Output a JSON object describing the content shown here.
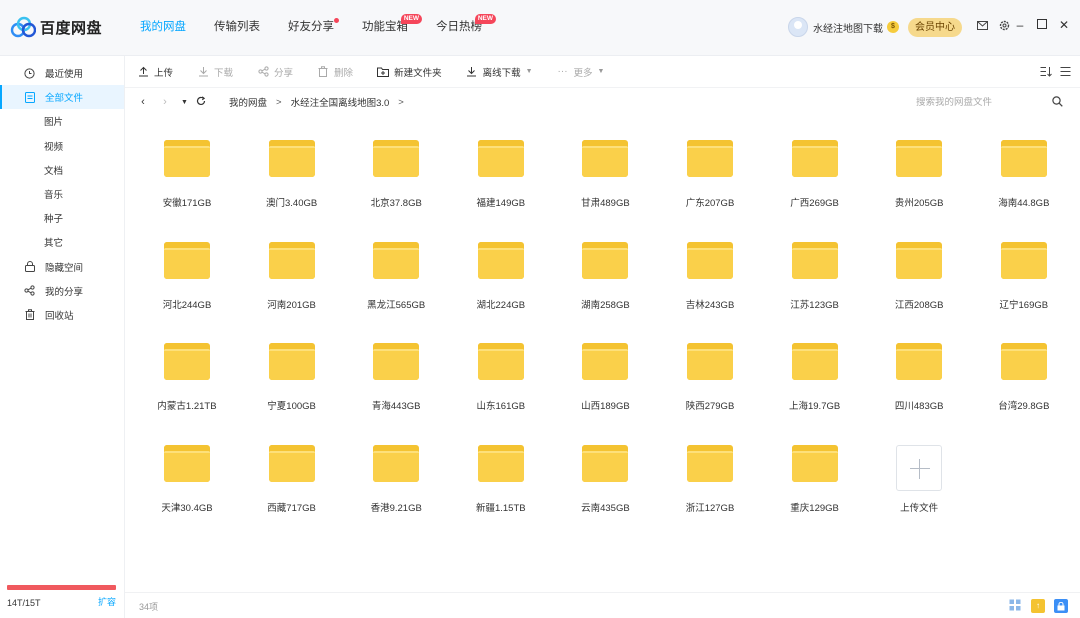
{
  "app": {
    "name": "百度网盘"
  },
  "nav": {
    "tabs": [
      {
        "label": "我的网盘",
        "active": true,
        "badge": ""
      },
      {
        "label": "传输列表",
        "active": false,
        "badge": ""
      },
      {
        "label": "好友分享",
        "active": false,
        "badge": "dot"
      },
      {
        "label": "功能宝箱",
        "active": false,
        "badge": "NEW"
      },
      {
        "label": "今日热榜",
        "active": false,
        "badge": "NEW"
      }
    ]
  },
  "user": {
    "name": "水经注地图下载",
    "vip_button": "会员中心"
  },
  "sidebar": {
    "items": [
      {
        "label": "最近使用",
        "icon": "clock-icon"
      },
      {
        "label": "全部文件",
        "icon": "file-icon",
        "active": true
      },
      {
        "label": "图片",
        "sub": true
      },
      {
        "label": "视频",
        "sub": true
      },
      {
        "label": "文档",
        "sub": true
      },
      {
        "label": "音乐",
        "sub": true
      },
      {
        "label": "种子",
        "sub": true
      },
      {
        "label": "其它",
        "sub": true
      },
      {
        "label": "隐藏空间",
        "icon": "lock-icon"
      },
      {
        "label": "我的分享",
        "icon": "share-icon"
      },
      {
        "label": "回收站",
        "icon": "trash-icon"
      }
    ],
    "storage_text": "14T/15T",
    "expand_label": "扩容",
    "storage_color": "#f0595e"
  },
  "toolbar": {
    "upload": "上传",
    "download": "下载",
    "share": "分享",
    "delete": "删除",
    "new_folder": "新建文件夹",
    "offline": "离线下载",
    "more": "更多"
  },
  "breadcrumb": {
    "root": "我的网盘",
    "current": "水经注全国离线地图3.0"
  },
  "search": {
    "placeholder": "搜索我的网盘文件"
  },
  "files": [
    "安徽171GB",
    "澳门3.40GB",
    "北京37.8GB",
    "福建149GB",
    "甘肃489GB",
    "广东207GB",
    "广西269GB",
    "贵州205GB",
    "海南44.8GB",
    "河北244GB",
    "河南201GB",
    "黑龙江565GB",
    "湖北224GB",
    "湖南258GB",
    "吉林243GB",
    "江苏123GB",
    "江西208GB",
    "辽宁169GB",
    "内蒙古1.21TB",
    "宁夏100GB",
    "青海443GB",
    "山东161GB",
    "山西189GB",
    "陕西279GB",
    "上海19.7GB",
    "四川483GB",
    "台湾29.8GB",
    "天津30.4GB",
    "西藏717GB",
    "香港9.21GB",
    "新疆1.15TB",
    "云南435GB",
    "浙江127GB",
    "重庆129GB"
  ],
  "upload_tile": {
    "label": "上传文件"
  },
  "status": {
    "count": "34项"
  },
  "colors": {
    "accent": "#06a7ff",
    "folder": "#fad04a"
  }
}
